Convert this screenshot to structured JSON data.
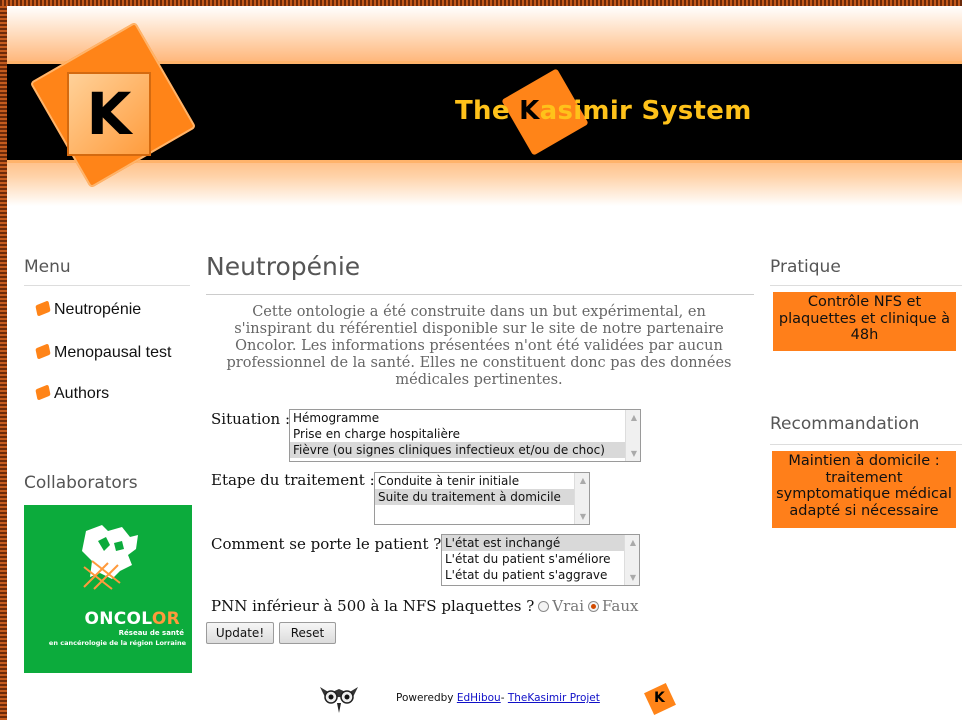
{
  "header": {
    "logo_letter": "K",
    "title_prefix": "The ",
    "title_k": "K",
    "title_suffix": "asimir System"
  },
  "menu": {
    "heading": "Menu",
    "items": [
      {
        "label": "Neutropénie"
      },
      {
        "label": "Menopausal test"
      },
      {
        "label": "Authors"
      }
    ]
  },
  "collaborators": {
    "heading": "Collaborators",
    "logo_name_a": "ONCOL",
    "logo_name_b": "OR",
    "logo_line1": "Réseau de santé",
    "logo_line2": "en cancérologie de la région Lorraine"
  },
  "main": {
    "title": "Neutropénie",
    "intro": "Cette ontologie a été construite dans un but expérimental, en s'inspirant du référentiel disponible sur le site de notre partenaire Oncolor. Les informations présentées n'ont été validées par aucun professionnel de la santé. Elles ne constituent donc pas des données médicales pertinentes.",
    "situation": {
      "label": "Situation :",
      "options": [
        "Hémogramme",
        "Prise en charge hospitalière",
        "Fièvre (ou signes cliniques infectieux et/ou de choc)"
      ],
      "selected": "Fièvre (ou signes cliniques infectieux et/ou de choc)"
    },
    "etape": {
      "label": "Etape du traitement :",
      "options": [
        "Conduite à tenir initiale",
        "Suite du traitement à domicile"
      ],
      "selected": "Suite du traitement à domicile"
    },
    "etat": {
      "label": "Comment se porte le patient ?",
      "options": [
        "L'état est inchangé",
        "L'état du patient s'améliore",
        "L'état du patient s'aggrave"
      ],
      "selected": "L'état est inchangé"
    },
    "pnn": {
      "label": "PNN inférieur à 500 à la NFS plaquettes ?",
      "vrai": "Vrai",
      "faux": "Faux",
      "selected": "Faux"
    },
    "update_label": "Update!",
    "reset_label": "Reset"
  },
  "right": {
    "pratique_heading": "Pratique",
    "pratique_text": "Contrôle NFS et plaquettes et clinique à 48h",
    "recommandation_heading": "Recommandation",
    "recommandation_text": "Maintien à domicile : traitement symptomatique médical adapté si nécessaire",
    "box_color": "#ff7f1a"
  },
  "footer": {
    "powered": "Poweredby ",
    "edhibou": "EdHibou",
    "sep": "- ",
    "project": "TheKasimir Projet",
    "k": "K"
  }
}
